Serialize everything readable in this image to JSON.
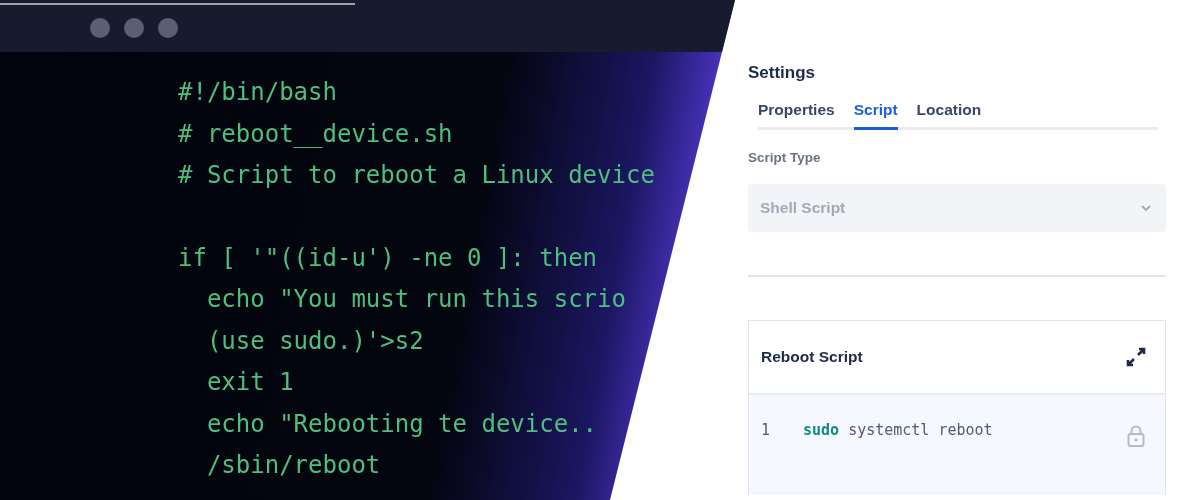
{
  "terminal": {
    "lines": [
      {
        "text": "#!/bin/bash",
        "blank_before": false
      },
      {
        "text": "# reboot__device.sh",
        "blank_before": false
      },
      {
        "text": "# Script to reboot a Linux device",
        "blank_before": false
      },
      {
        "text": "if [ '\"((id-u') -ne 0 ]: then",
        "blank_before": true
      },
      {
        "text": "  echo \"You must run this scrio",
        "blank_before": false
      },
      {
        "text": "  (use sudo.)'>s2",
        "blank_before": false
      },
      {
        "text": "  exit 1",
        "blank_before": false
      },
      {
        "text": "  echo \"Rebooting te device..",
        "blank_before": false
      },
      {
        "text": "  /sbin/reboot",
        "blank_before": false
      }
    ]
  },
  "settings": {
    "title": "Settings",
    "tabs": [
      {
        "label": "Properties",
        "selected": false
      },
      {
        "label": "Script",
        "selected": true
      },
      {
        "label": "Location",
        "selected": false
      }
    ],
    "script_type": {
      "label": "Script Type",
      "value": "Shell Script",
      "disabled": true
    },
    "editor": {
      "title": "Reboot Script",
      "lines": [
        {
          "number": "1",
          "locked": true,
          "tokens": [
            {
              "text": "sudo",
              "kind": "keyword"
            },
            {
              "text": "systemctl reboot",
              "kind": "plain"
            }
          ]
        }
      ]
    }
  }
}
